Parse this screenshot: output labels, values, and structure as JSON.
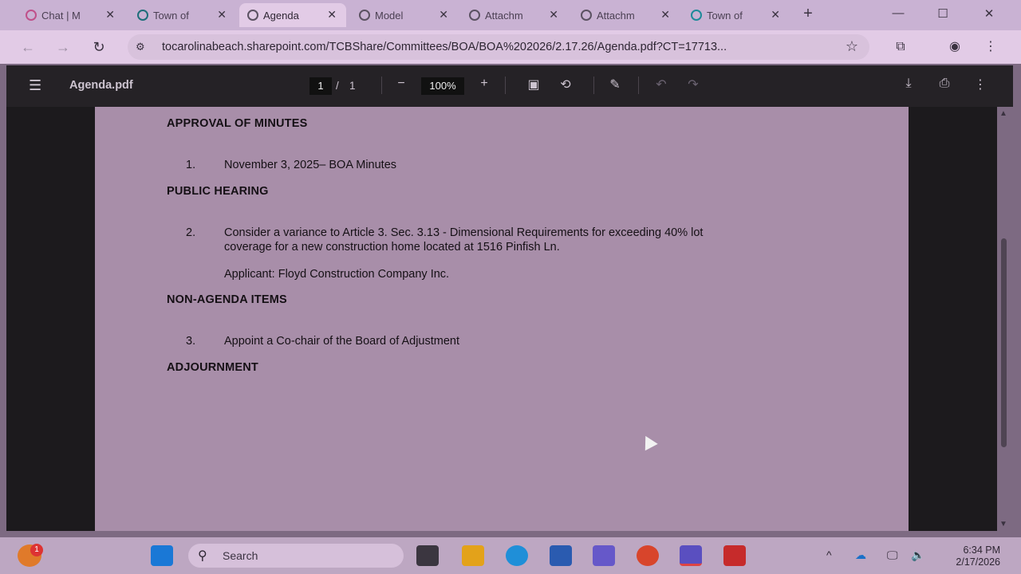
{
  "browser": {
    "tabs": [
      {
        "title": "Chat | M",
        "active": false
      },
      {
        "title": "Town of",
        "active": false
      },
      {
        "title": "Agenda",
        "active": true
      },
      {
        "title": "Model",
        "active": false
      },
      {
        "title": "Attachm",
        "active": false
      },
      {
        "title": "Attachm",
        "active": false
      },
      {
        "title": "Town of",
        "active": false
      }
    ],
    "url": "tocarolinabeach.sharepoint.com/TCBShare/Committees/BOA/BOA%202026/2.17.26/Agenda.pdf?CT=17713..."
  },
  "pdf_toolbar": {
    "doc_title": "Agenda.pdf",
    "current_page": "1",
    "page_sep": "/",
    "total_pages": "1",
    "zoom": "100%"
  },
  "document": {
    "approval_heading": "APPROVAL OF MINUTES",
    "item1_num": "1.",
    "item1_text": "November 3, 2025– BOA Minutes",
    "public_heading": "PUBLIC HEARING",
    "item2_num": "2.",
    "item2_line1": "Consider a variance to Article 3. Sec. 3.13 - Dimensional Requirements for exceeding 40% lot",
    "item2_line2": "coverage for a new construction home located at 1516 Pinfish Ln.",
    "applicant": "Applicant: Floyd Construction Company Inc.",
    "nonagenda_heading": "NON-AGENDA ITEMS",
    "item3_num": "3.",
    "item3_text": "Appoint a Co-chair of the Board of Adjustment",
    "adjournment_heading": "ADJOURNMENT"
  },
  "taskbar": {
    "notification_count": "1",
    "search_placeholder": "Search",
    "time": "6:34 PM",
    "date": "2/17/2026"
  }
}
